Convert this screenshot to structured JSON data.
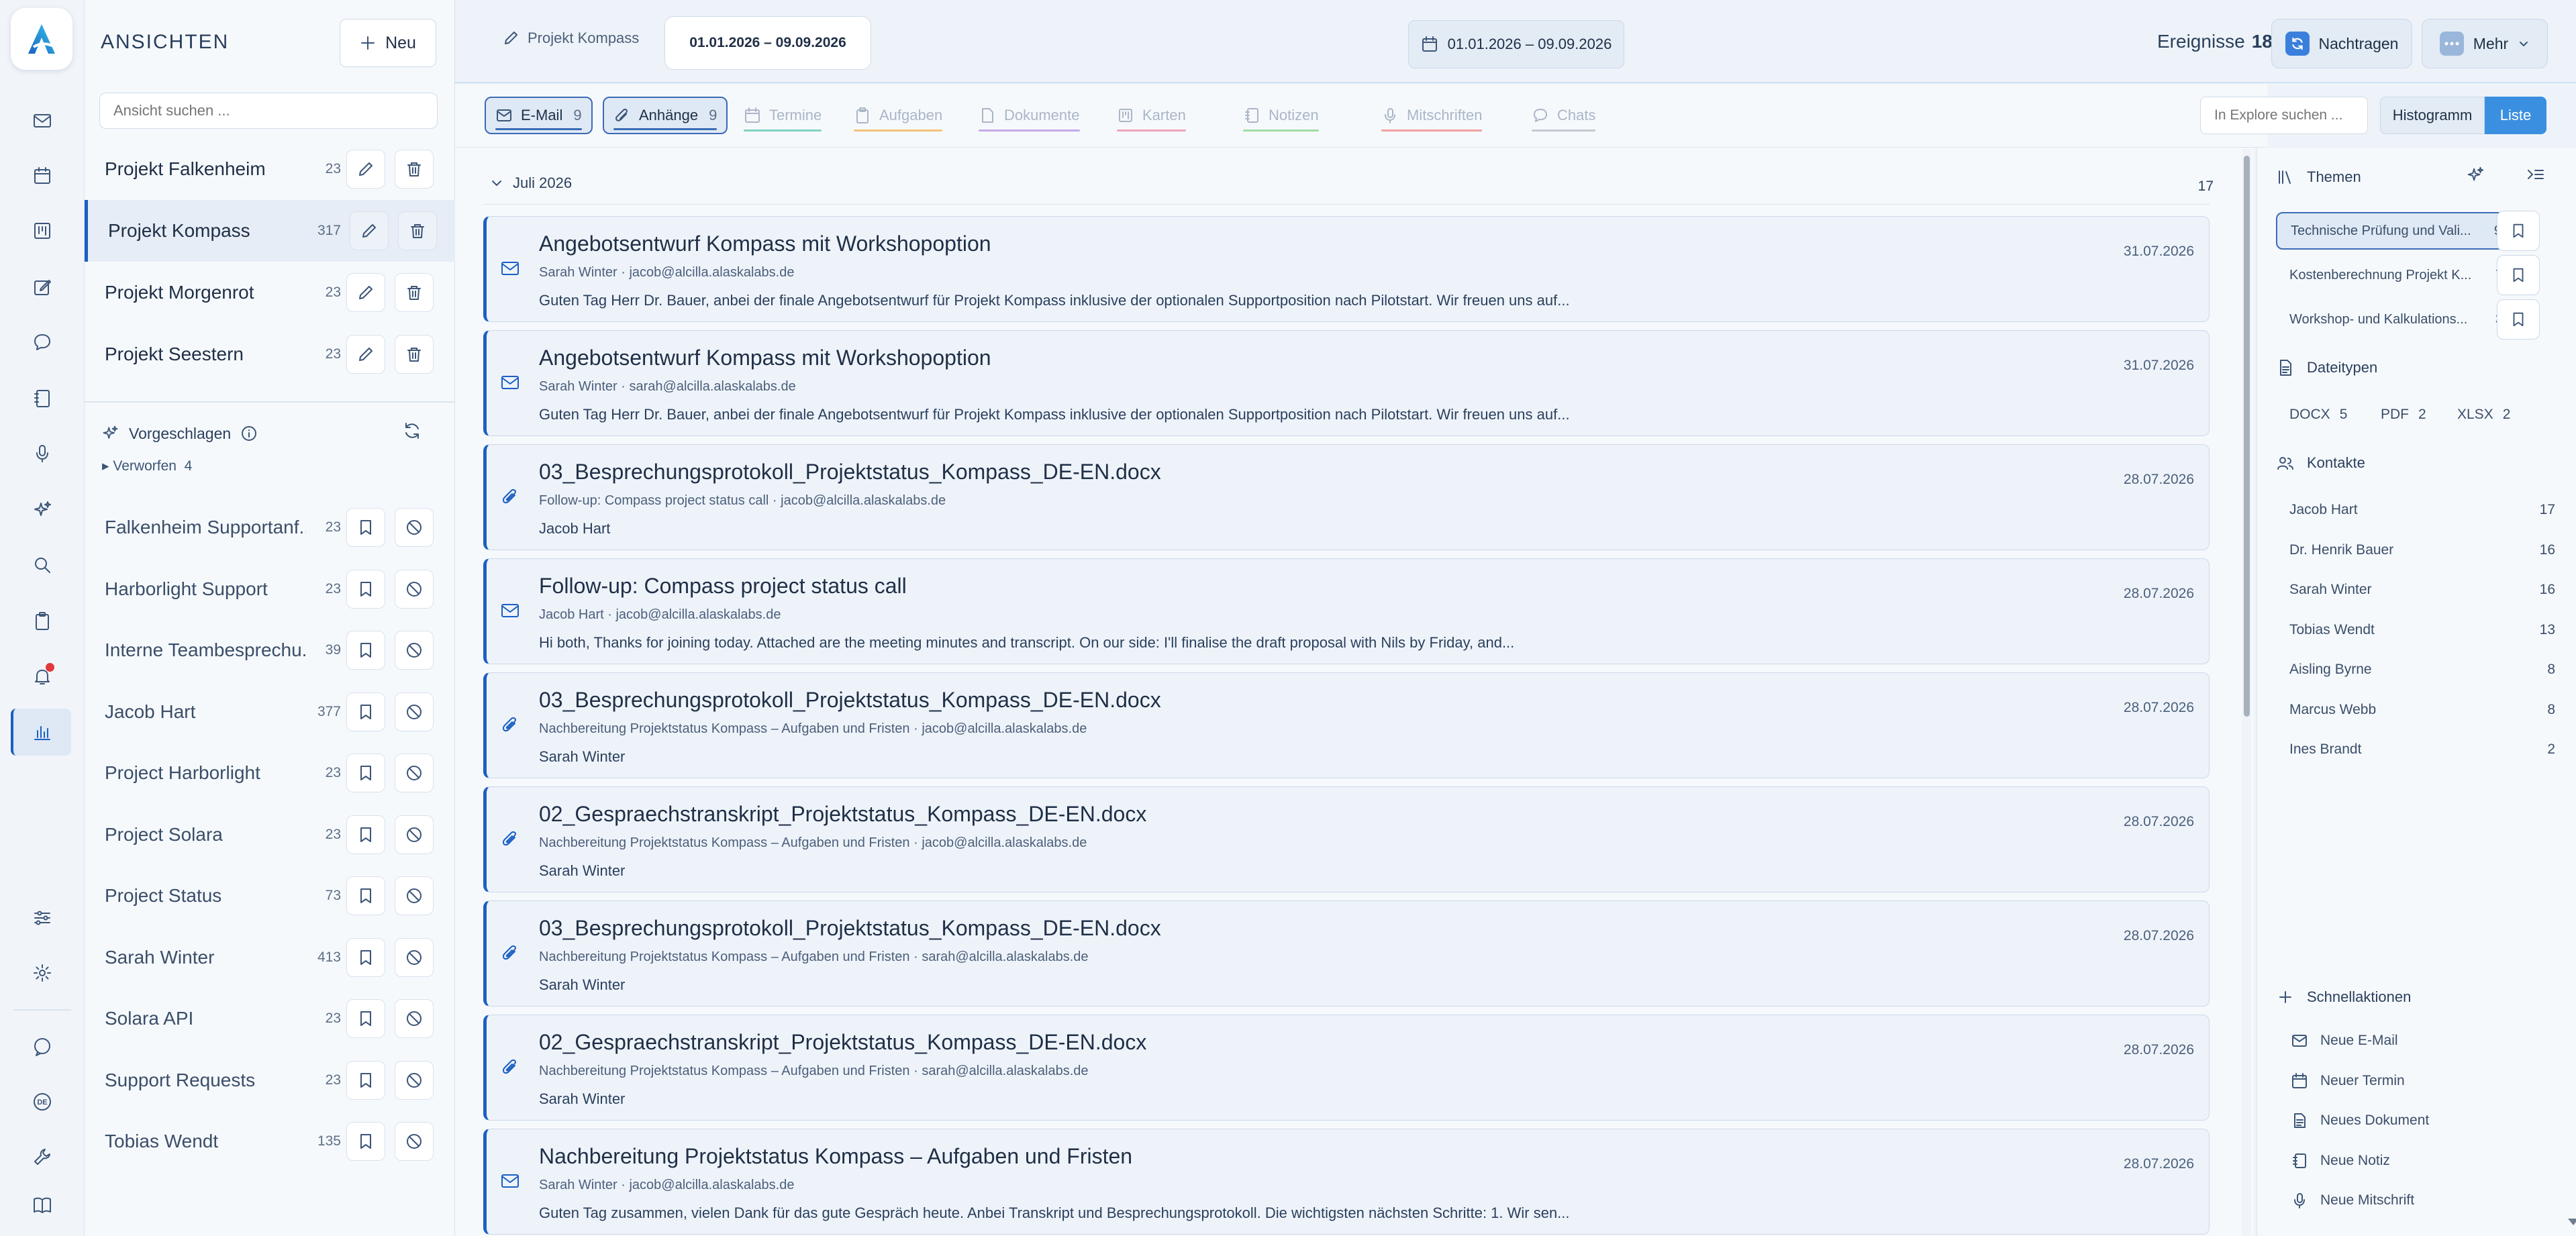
{
  "rail": {
    "icons": [
      "mail-icon",
      "calendar-icon",
      "board-icon",
      "edit-icon",
      "chat-icon",
      "notebook-icon",
      "microphone-icon",
      "sparkles-icon",
      "search-icon",
      "clipboard-icon",
      "bell-icon",
      "chart-icon",
      "sliders-icon",
      "gear-icon",
      "bubble-icon",
      "language-icon",
      "wrench-icon",
      "book-icon"
    ],
    "language_badge": "DE"
  },
  "views": {
    "title": "ANSICHTEN",
    "new_label": "Neu",
    "search_placeholder": "Ansicht suchen ...",
    "items": [
      {
        "name": "Projekt Falkenheim",
        "count": "23"
      },
      {
        "name": "Projekt Kompass",
        "count": "317"
      },
      {
        "name": "Projekt Morgenrot",
        "count": "23"
      },
      {
        "name": "Projekt Seestern",
        "count": "23"
      }
    ],
    "suggested_label": "Vorgeschlagen",
    "rejected_label": "Verworfen",
    "rejected_count": "4",
    "suggested": [
      {
        "name": "Falkenheim Supportanf...",
        "count": "23"
      },
      {
        "name": "Harborlight Support",
        "count": "23"
      },
      {
        "name": "Interne Teambesprechu...",
        "count": "39"
      },
      {
        "name": "Jacob Hart",
        "count": "377"
      },
      {
        "name": "Project Harborlight",
        "count": "23"
      },
      {
        "name": "Project Solara",
        "count": "23"
      },
      {
        "name": "Project Status",
        "count": "73"
      },
      {
        "name": "Sarah Winter",
        "count": "413"
      },
      {
        "name": "Solara API",
        "count": "23"
      },
      {
        "name": "Support Requests",
        "count": "23"
      },
      {
        "name": "Tobias Wendt",
        "count": "135"
      }
    ]
  },
  "topbar": {
    "project_tab": "Projekt Kompass",
    "date_tab": "01.01.2026 – 09.09.2026",
    "date_picker": "01.01.2026 – 09.09.2026",
    "events_label": "Ereignisse",
    "events_count": "18",
    "catchup_label": "Nachtragen",
    "more_label": "Mehr"
  },
  "filters": {
    "tabs": [
      {
        "label": "E-Mail",
        "count": "9",
        "on": true,
        "color": "#3a6bb5"
      },
      {
        "label": "Anhänge",
        "count": "9",
        "on": true,
        "color": "#3a6bb5"
      },
      {
        "label": "Termine",
        "count": "",
        "on": false,
        "color": "#7fd3c4"
      },
      {
        "label": "Aufgaben",
        "count": "",
        "on": false,
        "color": "#f2c27a"
      },
      {
        "label": "Dokumente",
        "count": "",
        "on": false,
        "color": "#c5a8e8"
      },
      {
        "label": "Karten",
        "count": "",
        "on": false,
        "color": "#f0a3b8"
      },
      {
        "label": "Notizen",
        "count": "",
        "on": false,
        "color": "#9fdca6"
      },
      {
        "label": "Mitschriften",
        "count": "",
        "on": false,
        "color": "#f1a0a0"
      },
      {
        "label": "Chats",
        "count": "",
        "on": false,
        "color": "#c3cad3"
      }
    ],
    "explore_placeholder": "In Explore suchen ...",
    "histogram_label": "Histogramm",
    "list_label": "Liste"
  },
  "list": {
    "month": "Juli 2026",
    "month_count": "17",
    "items": [
      {
        "type": "mail",
        "title": "Angebotsentwurf Kompass mit Workshopoption",
        "sub": "Sarah Winter · jacob@alcilla.alaskalabs.de",
        "preview": "Guten Tag Herr Dr. Bauer, anbei der finale Angebotsentwurf für Projekt Kompass inklusive der optionalen Supportposition nach Pilotstart. Wir freuen uns auf...",
        "date": "31.07.2026"
      },
      {
        "type": "mail",
        "title": "Angebotsentwurf Kompass mit Workshopoption",
        "sub": "Sarah Winter · sarah@alcilla.alaskalabs.de",
        "preview": "Guten Tag Herr Dr. Bauer, anbei der finale Angebotsentwurf für Projekt Kompass inklusive der optionalen Supportposition nach Pilotstart. Wir freuen uns auf...",
        "date": "31.07.2026"
      },
      {
        "type": "attach",
        "title": "03_Besprechungsprotokoll_Projektstatus_Kompass_DE-EN.docx",
        "sub": "Follow-up: Compass project status call · jacob@alcilla.alaskalabs.de",
        "preview": "Jacob Hart",
        "date": "28.07.2026"
      },
      {
        "type": "mail",
        "title": "Follow-up: Compass project status call",
        "sub": "Jacob Hart · jacob@alcilla.alaskalabs.de",
        "preview": "Hi both, Thanks for joining today. Attached are the meeting minutes and transcript. On our side: I'll finalise the draft proposal with Nils by Friday, and...",
        "date": "28.07.2026"
      },
      {
        "type": "attach",
        "title": "03_Besprechungsprotokoll_Projektstatus_Kompass_DE-EN.docx",
        "sub": "Nachbereitung Projektstatus Kompass – Aufgaben und Fristen · jacob@alcilla.alaskalabs.de",
        "preview": "Sarah Winter",
        "date": "28.07.2026"
      },
      {
        "type": "attach",
        "title": "02_Gespraechstranskript_Projektstatus_Kompass_DE-EN.docx",
        "sub": "Nachbereitung Projektstatus Kompass – Aufgaben und Fristen · jacob@alcilla.alaskalabs.de",
        "preview": "Sarah Winter",
        "date": "28.07.2026"
      },
      {
        "type": "attach",
        "title": "03_Besprechungsprotokoll_Projektstatus_Kompass_DE-EN.docx",
        "sub": "Nachbereitung Projektstatus Kompass – Aufgaben und Fristen · sarah@alcilla.alaskalabs.de",
        "preview": "Sarah Winter",
        "date": "28.07.2026"
      },
      {
        "type": "attach",
        "title": "02_Gespraechstranskript_Projektstatus_Kompass_DE-EN.docx",
        "sub": "Nachbereitung Projektstatus Kompass – Aufgaben und Fristen · sarah@alcilla.alaskalabs.de",
        "preview": "Sarah Winter",
        "date": "28.07.2026"
      },
      {
        "type": "mail",
        "title": "Nachbereitung Projektstatus Kompass – Aufgaben und Fristen",
        "sub": "Sarah Winter · jacob@alcilla.alaskalabs.de",
        "preview": "Guten Tag zusammen, vielen Dank für das gute Gespräch heute. Anbei Transkript und Besprechungsprotokoll. Die wichtigsten nächsten Schritte: 1. Wir sen...",
        "date": "28.07.2026"
      }
    ]
  },
  "right": {
    "topics_label": "Themen",
    "topics": [
      {
        "name": "Technische Prüfung und Vali...",
        "count": "9"
      },
      {
        "name": "Kostenberechnung Projekt K...",
        "count": "7"
      },
      {
        "name": "Workshop- und Kalkulations...",
        "count": "3"
      }
    ],
    "filetypes_label": "Dateitypen",
    "filetypes": [
      {
        "name": "DOCX",
        "count": "5"
      },
      {
        "name": "PDF",
        "count": "2"
      },
      {
        "name": "XLSX",
        "count": "2"
      }
    ],
    "contacts_label": "Kontakte",
    "contacts": [
      {
        "name": "Jacob Hart",
        "count": "17"
      },
      {
        "name": "Dr. Henrik Bauer",
        "count": "16"
      },
      {
        "name": "Sarah Winter",
        "count": "16"
      },
      {
        "name": "Tobias Wendt",
        "count": "13"
      },
      {
        "name": "Aisling Byrne",
        "count": "8"
      },
      {
        "name": "Marcus Webb",
        "count": "8"
      },
      {
        "name": "Ines Brandt",
        "count": "2"
      }
    ],
    "quick_label": "Schnellaktionen",
    "quick": [
      {
        "name": "Neue E-Mail",
        "icon": "mail-icon"
      },
      {
        "name": "Neuer Termin",
        "icon": "calendar-icon"
      },
      {
        "name": "Neues Dokument",
        "icon": "document-icon"
      },
      {
        "name": "Neue Notiz",
        "icon": "notebook-icon"
      },
      {
        "name": "Neue Mitschrift",
        "icon": "microphone-icon"
      }
    ]
  }
}
